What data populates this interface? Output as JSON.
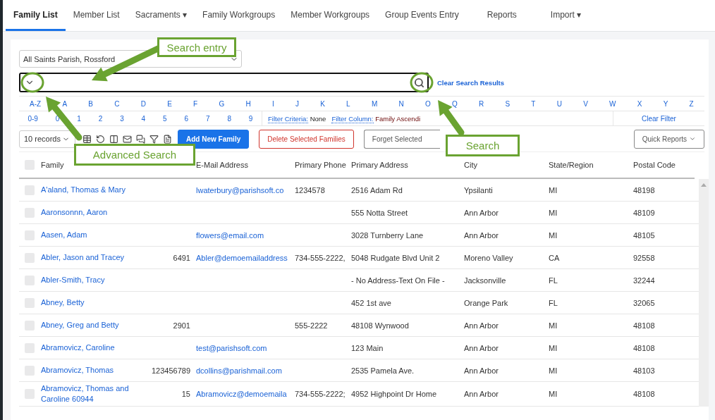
{
  "tabs": [
    {
      "label": "Family List",
      "selected": true
    },
    {
      "label": "Member List",
      "selected": false
    },
    {
      "label": "Sacraments",
      "selected": false,
      "caret": "▾"
    },
    {
      "label": "Family Workgroups",
      "selected": false
    },
    {
      "label": "Member Workgroups",
      "selected": false
    },
    {
      "label": "Group Events Entry",
      "selected": false
    },
    {
      "label": "Reports",
      "selected": false
    },
    {
      "label": "Import",
      "selected": false,
      "caret": "▾"
    }
  ],
  "parish_select": {
    "value": "All Saints Parish, Rossford"
  },
  "search": {
    "clear_link": "Clear Search Results"
  },
  "letters": [
    "A-Z",
    "A",
    "B",
    "C",
    "D",
    "E",
    "F",
    "G",
    "H",
    "I",
    "J",
    "K",
    "L",
    "M",
    "N",
    "O",
    "Q",
    "R",
    "S",
    "T",
    "U",
    "V",
    "W",
    "X",
    "Y",
    "Z"
  ],
  "digits": [
    "0-9",
    "0",
    "1",
    "2",
    "3",
    "4",
    "5",
    "6",
    "7",
    "8",
    "9"
  ],
  "filter_criteria": {
    "label": "Filter Criteria:",
    "value": "None"
  },
  "filter_column": {
    "label": "Filter Column:",
    "value": "Family Ascendi"
  },
  "clear_filter": "Clear Filter",
  "toolbar": {
    "page_size": "10 records",
    "add_button": "Add New Family",
    "delete_button": "Delete Selected Families",
    "forget_button": "Forget Selected",
    "reports_button": "Quick Reports"
  },
  "table": {
    "all_checked": false,
    "columns": [
      "Family",
      "",
      "E-Mail Address",
      "Primary Phone",
      "Primary Address",
      "City",
      "State/Region",
      "Postal Code"
    ],
    "rows": [
      {
        "checked": false,
        "cells": [
          "A'aland, Thomas & Mary",
          "",
          "lwaterbury@parishsoft.co",
          "1234578",
          "2516 Adam Rd",
          "Ypsilanti",
          "MI",
          "48198"
        ]
      },
      {
        "checked": false,
        "cells": [
          "Aaronsonnn, Aaron",
          "",
          "",
          "",
          "555 Notta Street",
          "Ann Arbor",
          "MI",
          "48109"
        ]
      },
      {
        "checked": false,
        "cells": [
          "Aasen, Adam",
          "",
          "flowers@email.com",
          "",
          "3028 Turnberry Lane",
          "Ann Arbor",
          "MI",
          "48105"
        ]
      },
      {
        "checked": false,
        "cells": [
          "Abler, Jason and Tracey",
          "6491",
          "Abler@demoemailaddress",
          "734-555-2222,",
          "5048 Rudgate Blvd Unit 2",
          "Moreno Valley",
          "CA",
          "92558"
        ]
      },
      {
        "checked": false,
        "cells": [
          "Abler-Smith, Tracy",
          "",
          "",
          "",
          "- No Address-Text On File -",
          "Jacksonville",
          "FL",
          "32244"
        ]
      },
      {
        "checked": false,
        "cells": [
          "Abney, Betty",
          "",
          "",
          "",
          "452 1st ave",
          "Orange Park",
          "FL",
          "32065"
        ]
      },
      {
        "checked": false,
        "cells": [
          "Abney, Greg and Betty",
          "2901",
          "",
          "555-2222",
          "48108 Wynwood",
          "Ann Arbor",
          "MI",
          "48108"
        ]
      },
      {
        "checked": false,
        "cells": [
          "Abramovicz, Caroline",
          "",
          "test@parishsoft.com",
          "",
          "123 Main",
          "Ann Arbor",
          "MI",
          "48108"
        ]
      },
      {
        "checked": false,
        "cells": [
          "Abramovicz, Thomas",
          "123456789",
          "dcollins@parishmail.com",
          "",
          "2535 Pamela Ave.",
          "Ann Arbor",
          "MI",
          "48103"
        ]
      },
      {
        "checked": false,
        "cells": [
          "Abramovicz, Thomas and Caroline 60944",
          "15",
          "Abramovicz@demoemaila",
          "734-555-2222;",
          "4952 Highpoint Dr Home",
          "Ann Arbor",
          "MI",
          "48108"
        ]
      }
    ]
  },
  "callouts": [
    "Search entry",
    "Advanced Search",
    "Search"
  ]
}
